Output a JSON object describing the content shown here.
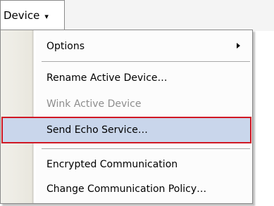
{
  "menubar": {
    "device_label": "Device",
    "device_caret": "▾"
  },
  "dropdown": {
    "items": [
      {
        "label": "Options",
        "has_submenu": true,
        "enabled": true
      },
      {
        "label": "Rename Active Device…",
        "has_submenu": false,
        "enabled": true
      },
      {
        "label": "Wink Active Device",
        "has_submenu": false,
        "enabled": false
      },
      {
        "label": "Send Echo Service…",
        "has_submenu": false,
        "enabled": true,
        "highlighted": true
      },
      {
        "label": "Encrypted Communication",
        "has_submenu": false,
        "enabled": true
      },
      {
        "label": "Change Communication Policy…",
        "has_submenu": false,
        "enabled": true
      }
    ]
  },
  "colors": {
    "highlight_fill": "#c9d6eb",
    "highlight_border": "#d01824",
    "disabled_text": "#8d8d8d"
  },
  "icons": {
    "submenu_arrow": "submenu-arrow-icon",
    "dropdown_caret": "caret-down-icon"
  }
}
